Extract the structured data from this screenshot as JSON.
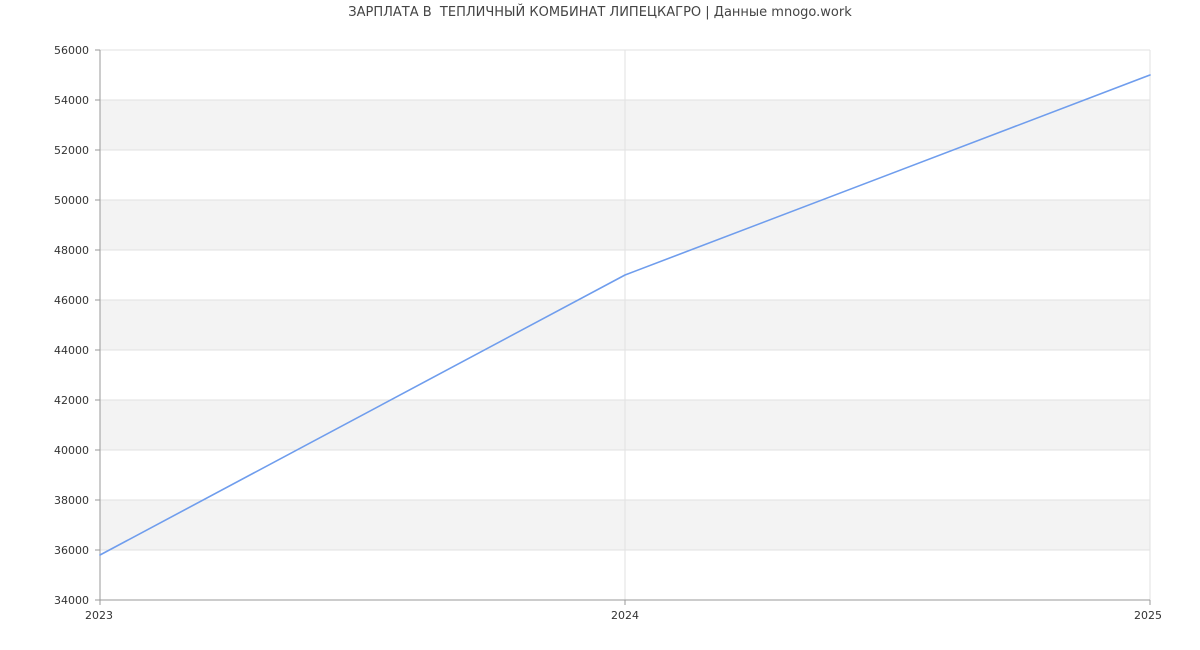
{
  "chart_data": {
    "type": "line",
    "title": "ЗАРПЛАТА В  ТЕПЛИЧНЫЙ КОМБИНАТ ЛИПЕЦКАГРО | Данные mnogo.work",
    "xlabel": "",
    "ylabel": "",
    "x": [
      2023,
      2024,
      2025
    ],
    "x_tick_labels": [
      "2023",
      "2024",
      "2025"
    ],
    "series": [
      {
        "values": [
          35800,
          47000,
          55000
        ]
      }
    ],
    "ylim": [
      34000,
      56000
    ],
    "y_ticks": [
      34000,
      36000,
      38000,
      40000,
      42000,
      44000,
      46000,
      48000,
      50000,
      52000,
      54000,
      56000
    ],
    "grid": true,
    "alternating_bands": true,
    "legend": "none",
    "colors": {
      "line": "#6f9ded",
      "band": "#f3f3f3",
      "grid": "#e2e2e2",
      "axis": "#999999",
      "text": "#333333"
    }
  }
}
